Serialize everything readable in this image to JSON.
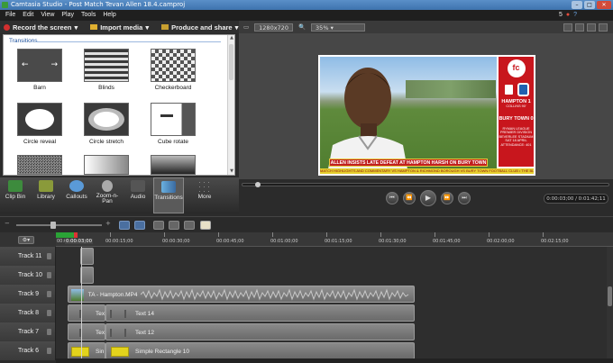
{
  "window": {
    "title": "Camtasia Studio - Post Match Tevan Allen 18.4.camproj"
  },
  "menu": {
    "items": [
      "File",
      "Edit",
      "View",
      "Play",
      "Tools",
      "Help"
    ],
    "notif_count": "5"
  },
  "toolbar": {
    "record": "Record the screen",
    "import": "Import media",
    "produce": "Produce and share"
  },
  "preview_toolbar": {
    "resolution": "1280x720",
    "zoom": "35%"
  },
  "clip_panel": {
    "legend": "Transitions",
    "items": [
      "Barn",
      "Blinds",
      "Checkerboard",
      "Circle reveal",
      "Circle stretch",
      "Cube rotate"
    ]
  },
  "tabs": [
    {
      "label": "Clip Bin"
    },
    {
      "label": "Library"
    },
    {
      "label": "Callouts"
    },
    {
      "label": "Zoom-n-\nPan"
    },
    {
      "label": "Audio"
    },
    {
      "label": "Transitions"
    },
    {
      "label": "More"
    }
  ],
  "video": {
    "caption": "ALLEN INSISTS LATE DEFEAT AT HAMPTON HARSH ON BURY TOWN PLAYERS",
    "ticker": "MATCH HIGHLIGHTS AND COMMENTARY VS HAMPTON & RICHMOND BOROUGH VS BURY TOWN FOOTBALL CLUB • THE BLUES",
    "logo": "fc",
    "home": "HAMPTON 1",
    "scorer": "COLLINS 90'",
    "away": "BURY TOWN 0",
    "info": [
      "RYMAN LEAGUE",
      "PREMIER DIVISION",
      "BEVERLEE STADIUM",
      "SAT 18 APRIL",
      "ATTENDANCE: 401"
    ]
  },
  "transport": {
    "timecode": "0:00:03;00 / 0:01:42;11"
  },
  "ruler": {
    "playhead": "0:00:03;00",
    "labels": [
      "00:00:00;00",
      "00:00:15;00",
      "00:00:30;00",
      "00:00:45;00",
      "00:01:00;00",
      "00:01:15;00",
      "00:01:30;00",
      "00:01:45;00",
      "00:02:00;00",
      "00:02:15;00"
    ]
  },
  "tracks": [
    {
      "name": "Track 11"
    },
    {
      "name": "Track 10"
    },
    {
      "name": "Track 9"
    },
    {
      "name": "Track 8"
    },
    {
      "name": "Track 7"
    },
    {
      "name": "Track 6"
    }
  ],
  "clips": {
    "track9": "TA - Hampton.MP4",
    "track8_a": "Tex",
    "track8_b": "Text 14",
    "track7_a": "Tex",
    "track7_b": "Text 12",
    "track6_a": "Sin",
    "track6_b": "Simple Rectangle 10"
  },
  "colors": {
    "accent": "#c8161d",
    "playhead": "#2aa336",
    "rect": "#e3d31c"
  }
}
